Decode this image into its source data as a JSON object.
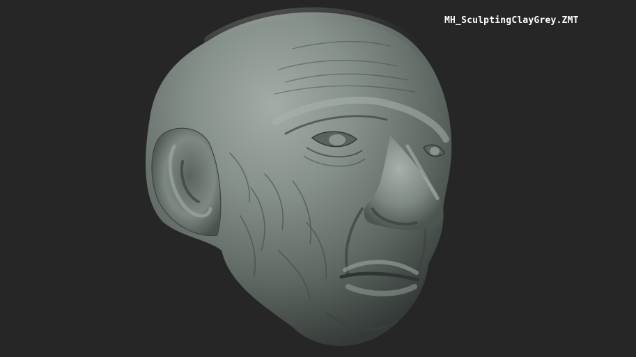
{
  "viewport": {
    "material_name": "MH_SculptingClayGrey.ZMT",
    "background_color": "#262626",
    "clay_color": "#7d8781"
  },
  "icons": {
    "sculpt": "sculpted-head-mesh"
  }
}
